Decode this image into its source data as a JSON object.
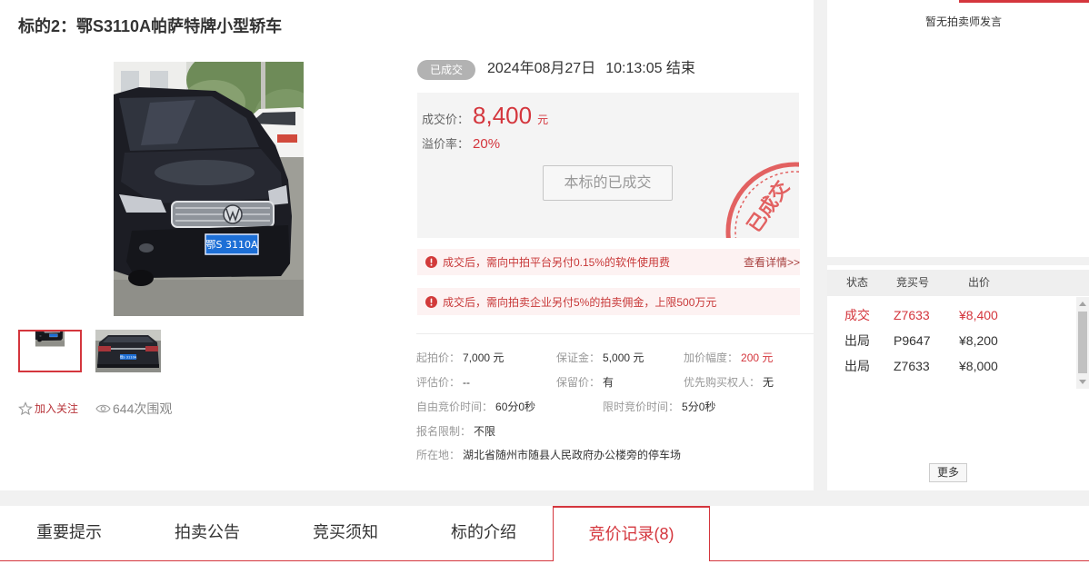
{
  "colors": {
    "accent": "#d4363d",
    "notice_bg": "#fdf2f2",
    "badge_bg": "#b2b2b2",
    "page_bg": "#f1f1f1",
    "header_bg": "#efefef"
  },
  "lot": {
    "title": "标的2：鄂S3110A帕萨特牌小型轿车"
  },
  "photo": {
    "plate": "鄂S 3110A",
    "thumbnails": [
      {
        "selected": true
      },
      {
        "selected": false
      }
    ]
  },
  "actions": {
    "follow_label": "加入关注",
    "follow_icon": "star-icon",
    "views_label": "644次围观",
    "views_icon": "eye-icon"
  },
  "status": {
    "badge": "已成交",
    "end_date": "2024年08月27日",
    "end_time": "10:13:05 结束"
  },
  "result": {
    "price_label": "成交价：",
    "price": "8,400",
    "price_unit": "元",
    "premium_label": "溢价率：",
    "premium": "20%",
    "button_label": "本标的已成交",
    "stamp_text": "已成交"
  },
  "notices": [
    {
      "icon": "alert-icon",
      "text": "成交后，需向中拍平台另付0.15%的软件使用费",
      "link": "查看详情>>"
    },
    {
      "icon": "alert-icon",
      "text": "成交后，需向拍卖企业另付5%的拍卖佣金，上限500万元"
    }
  ],
  "details": {
    "start_price": {
      "label": "起拍价：",
      "value": "7,000 元"
    },
    "deposit": {
      "label": "保证金：",
      "value": "5,000 元"
    },
    "increment": {
      "label": "加价幅度：",
      "value": "200 元"
    },
    "appraisal": {
      "label": "评估价：",
      "value": "--"
    },
    "reserve": {
      "label": "保留价：",
      "value": "有"
    },
    "priority": {
      "label": "优先购买权人：",
      "value": "无"
    },
    "free_bid_time": {
      "label": "自由竞价时间：",
      "value": "60分0秒"
    },
    "timed_bid_time": {
      "label": "限时竞价时间：",
      "value": "5分0秒"
    },
    "registration": {
      "label": "报名限制：",
      "value": "不限"
    },
    "location": {
      "label": "所在地：",
      "value": "湖北省随州市随县人民政府办公楼旁的停车场"
    }
  },
  "auctioneer": {
    "message": "暂无拍卖师发言"
  },
  "bids": {
    "headers": [
      "状态",
      "竞买号",
      "出价"
    ],
    "rows": [
      {
        "status": "成交",
        "bidder": "Z7633",
        "price": "¥8,400",
        "highlight": true
      },
      {
        "status": "出局",
        "bidder": "P9647",
        "price": "¥8,200",
        "highlight": false
      },
      {
        "status": "出局",
        "bidder": "Z7633",
        "price": "¥8,000",
        "highlight": false
      }
    ],
    "more_label": "更多"
  },
  "tabs": [
    {
      "label": "重要提示",
      "active": false
    },
    {
      "label": "拍卖公告",
      "active": false
    },
    {
      "label": "竞买须知",
      "active": false
    },
    {
      "label": "标的介绍",
      "active": false
    },
    {
      "label": "竞价记录(8)",
      "active": true
    }
  ]
}
